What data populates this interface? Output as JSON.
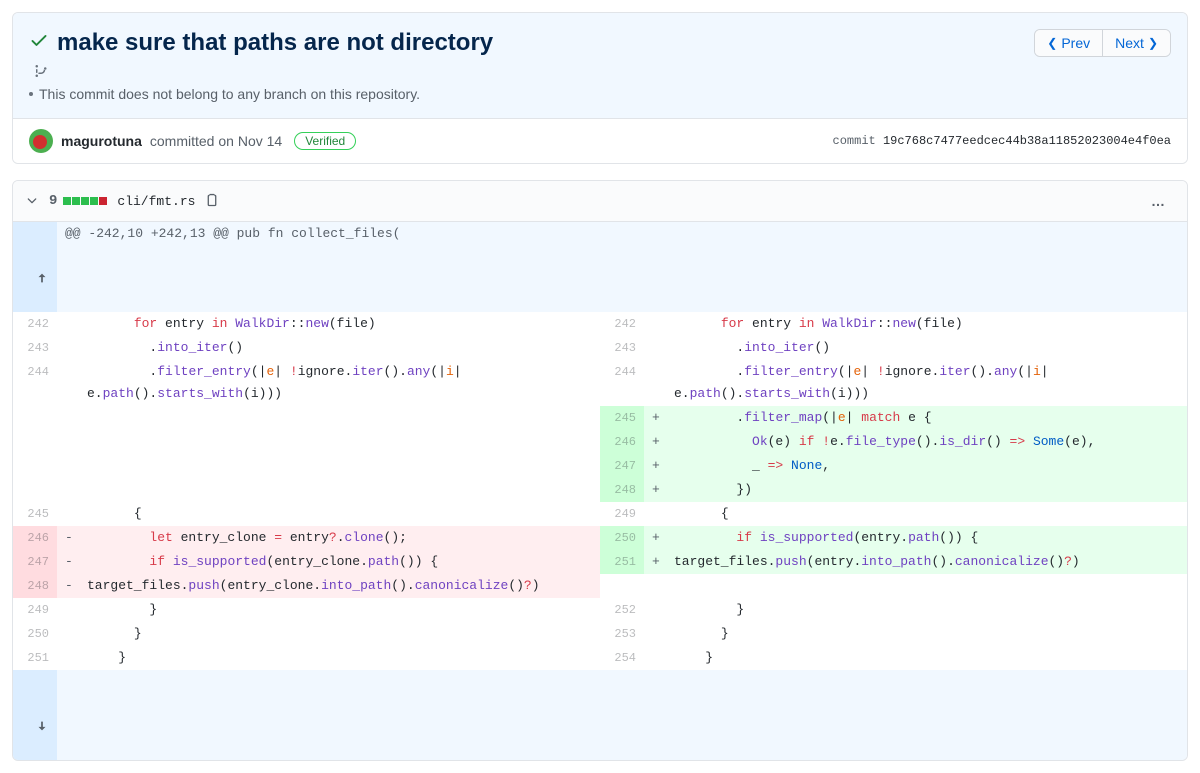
{
  "commit": {
    "title": "make sure that paths are not directory",
    "branch_note": "This commit does not belong to any branch on this repository.",
    "author": "magurotuna",
    "action": "committed",
    "date_prefix": "on",
    "date": "Nov 14",
    "verified_label": "Verified",
    "sha_label": "commit",
    "sha": "19c768c7477eedcec44b38a11852023004e4f0ea"
  },
  "nav": {
    "prev": "Prev",
    "next": "Next"
  },
  "file": {
    "diffstat_num": "9",
    "path": "cli/fmt.rs",
    "blocks": [
      "add",
      "add",
      "add",
      "add",
      "del"
    ]
  },
  "hunk_header": "@@ -242,10 +242,13 @@ pub fn collect_files(",
  "rows": [
    {
      "lnL": "242",
      "lnR": "242",
      "type": "ctx",
      "left_html": "      <span class='kw'>for</span> entry <span class='kw'>in</span> <span class='fn'>WalkDir</span>::<span class='fn'>new</span>(file)",
      "right_html": "      <span class='kw'>for</span> entry <span class='kw'>in</span> <span class='fn'>WalkDir</span>::<span class='fn'>new</span>(file)"
    },
    {
      "lnL": "243",
      "lnR": "243",
      "type": "ctx",
      "left_html": "        .<span class='fn'>into_iter</span>()",
      "right_html": "        .<span class='fn'>into_iter</span>()"
    },
    {
      "lnL": "244",
      "lnR": "244",
      "type": "ctx",
      "left_html": "        .<span class='fn'>filter_entry</span>(|<span class='param'>e</span>| <span class='op'>!</span>ignore.<span class='fn'>iter</span>().<span class='fn'>any</span>(|<span class='param'>i</span>| e.<span class='fn'>path</span>().<span class='fn'>starts_with</span>(i)))",
      "right_html": "        .<span class='fn'>filter_entry</span>(|<span class='param'>e</span>| <span class='op'>!</span>ignore.<span class='fn'>iter</span>().<span class='fn'>any</span>(|<span class='param'>i</span>| e.<span class='fn'>path</span>().<span class='fn'>starts_with</span>(i)))"
    },
    {
      "lnL": "",
      "lnR": "245",
      "type": "add",
      "left_html": "",
      "right_html": "        .<span class='fn'>filter_map</span>(|<span class='param'>e</span>| <span class='kw'>match</span> e {"
    },
    {
      "lnL": "",
      "lnR": "246",
      "type": "add",
      "left_html": "",
      "right_html": "          <span class='fn'>Ok</span>(e) <span class='kw'>if</span> <span class='op'>!</span>e.<span class='fn'>file_type</span>().<span class='fn'>is_dir</span>() <span class='op'>=&gt;</span> <span class='const'>Some</span>(e),"
    },
    {
      "lnL": "",
      "lnR": "247",
      "type": "add",
      "left_html": "",
      "right_html": "          _ <span class='op'>=&gt;</span> <span class='const'>None</span>,"
    },
    {
      "lnL": "",
      "lnR": "248",
      "type": "add",
      "left_html": "",
      "right_html": "        })"
    },
    {
      "lnL": "245",
      "lnR": "249",
      "type": "ctx",
      "left_html": "      {",
      "right_html": "      {"
    },
    {
      "lnL": "246",
      "lnR": "250",
      "type": "chg",
      "left_html": "        <span class='kw'>let</span> entry_clone <span class='op'>=</span> entry<span class='op'>?</span>.<span class='fn'>clone</span>();",
      "right_html": "        <span class='kw'>if</span> <span class='fn'>is_supported</span>(entry.<span class='fn'>path</span>()) {"
    },
    {
      "lnL": "247",
      "lnR": "251",
      "type": "chg",
      "left_html": "        <span class='kw'>if</span> <span class='fn'>is_supported</span>(entry_clone.<span class='fn'>path</span>()) {",
      "right_html": "target_files.<span class='fn'>push</span>(entry.<span class='fn'>into_path</span>().<span class='fn'>canonicalize</span>()<span class='op'>?</span>)"
    },
    {
      "lnL": "248",
      "lnR": "",
      "type": "del",
      "left_html": "target_files.<span class='fn'>push</span>(entry_clone.<span class='fn'>into_path</span>().<span class='fn'>canonicalize</span>()<span class='op'>?</span>)",
      "right_html": ""
    },
    {
      "lnL": "249",
      "lnR": "252",
      "type": "ctx",
      "left_html": "        }",
      "right_html": "        }"
    },
    {
      "lnL": "250",
      "lnR": "253",
      "type": "ctx",
      "left_html": "      }",
      "right_html": "      }"
    },
    {
      "lnL": "251",
      "lnR": "254",
      "type": "ctx",
      "left_html": "    }",
      "right_html": "    }"
    }
  ]
}
